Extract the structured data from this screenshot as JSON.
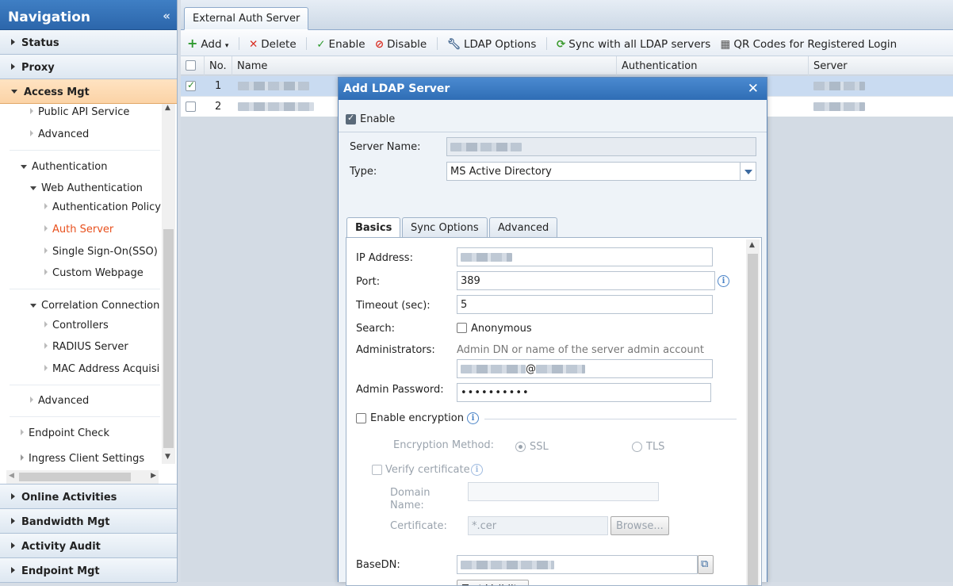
{
  "nav": {
    "title": "Navigation",
    "sections_top": [
      "Status",
      "Proxy",
      "Access Mgt"
    ],
    "tree": {
      "public_api": "Public API Service",
      "advanced1": "Advanced",
      "authentication": "Authentication",
      "web_auth": "Web Authentication",
      "auth_policy": "Authentication Policy",
      "auth_server": "Auth Server",
      "sso": "Single Sign-On(SSO)",
      "custom_webpage": "Custom Webpage",
      "correlation": "Correlation Connection",
      "controllers": "Controllers",
      "radius": "RADIUS Server",
      "mac": "MAC Address Acquisi",
      "advanced2": "Advanced",
      "endpoint_check": "Endpoint Check",
      "ingress": "Ingress Client Settings"
    },
    "sections_bottom": [
      "Online Activities",
      "Bandwidth Mgt",
      "Activity Audit",
      "Endpoint Mgt"
    ]
  },
  "main": {
    "tab": "External Auth Server",
    "toolbar": {
      "add": "Add",
      "delete": "Delete",
      "enable": "Enable",
      "disable": "Disable",
      "ldap_options": "LDAP Options",
      "sync": "Sync with all LDAP servers",
      "qr": "QR Codes for Registered Login"
    },
    "columns": [
      "No.",
      "Name",
      "Authentication",
      "Server"
    ],
    "rows": [
      {
        "no": "1",
        "checked": true
      },
      {
        "no": "2",
        "checked": false
      }
    ]
  },
  "dialog": {
    "title": "Add LDAP Server",
    "enable": "Enable",
    "server_name_label": "Server Name:",
    "type_label": "Type:",
    "type_value": "MS Active Directory",
    "tabs": [
      "Basics",
      "Sync Options",
      "Advanced"
    ],
    "ip_label": "IP Address:",
    "port_label": "Port:",
    "port_value": "389",
    "timeout_label": "Timeout (sec):",
    "timeout_value": "5",
    "search_label": "Search:",
    "anonymous": "Anonymous",
    "admins_label": "Administrators:",
    "admins_hint": "Admin DN or name of the server admin account",
    "admin_at": "@",
    "password_label": "Admin Password:",
    "password_value": "••••••••••",
    "enc_label": "Enable encryption",
    "enc_method_label": "Encryption Method:",
    "ssl": "SSL",
    "tls": "TLS",
    "verify_cert": "Verify certificate",
    "domain_name_label": "Domain Name:",
    "cert_label": "Certificate:",
    "cert_placeholder": "*.cer",
    "browse": "Browse...",
    "basedn_label": "BaseDN:",
    "test_validity": "Test Validity"
  }
}
